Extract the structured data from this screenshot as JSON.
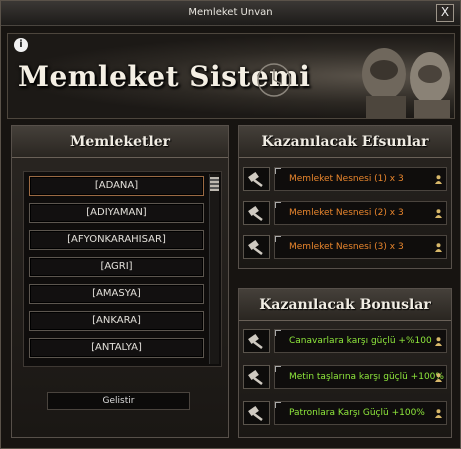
{
  "window": {
    "title": "Memleket Unvan",
    "close_label": "X"
  },
  "banner": {
    "title": "Memleket Sistemi"
  },
  "left_panel": {
    "header": "Memleketler",
    "cities": [
      "[ADANA]",
      "[ADIYAMAN]",
      "[AFYONKARAHISAR]",
      "[AGRI]",
      "[AMASYA]",
      "[ANKARA]",
      "[ANTALYA]"
    ],
    "develop_button": "Gelistir"
  },
  "enchant_panel": {
    "header": "Kazanılacak Efsunlar",
    "items": [
      "Memleket Nesnesi (1) x 3",
      "Memleket Nesnesi (2) x 3",
      "Memleket Nesnesi (3) x 3"
    ]
  },
  "bonus_panel": {
    "header": "Kazanılacak Bonuslar",
    "items": [
      "Canavarlara karşı güçlü +%100",
      "Metin taşlarına karşı güçlü +100%",
      "Patronlara Karşı Güçlü +100%"
    ]
  },
  "colors": {
    "reward_orange": "#e9862d",
    "bonus_green": "#8fe83c"
  },
  "icons": [
    "info-icon",
    "close-icon",
    "hammer-icon",
    "user-icon",
    "scroll-thumb-icon"
  ]
}
